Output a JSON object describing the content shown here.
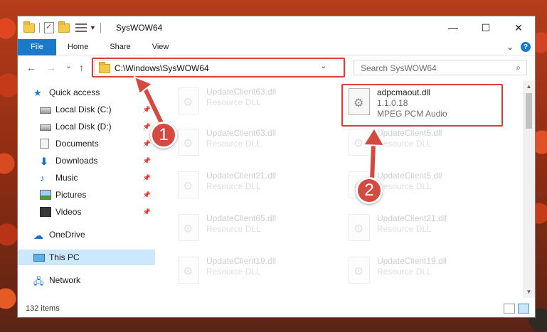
{
  "window": {
    "title": "SysWOW64"
  },
  "title_bar": {
    "minimize": "—",
    "maximize": "☐",
    "close": "✕"
  },
  "ribbon": {
    "tabs": [
      "File",
      "Home",
      "Share",
      "View"
    ],
    "collapse": "⌄",
    "help": "?"
  },
  "navigation": {
    "back": "←",
    "forward": "→",
    "recent": "⌄",
    "up": "↑",
    "address": "C:\\Windows\\SysWOW64",
    "address_dropdown": "⌄",
    "refresh": "↻",
    "search_placeholder": "Search SysWOW64",
    "search_icon": "⌕"
  },
  "sidebar": {
    "quick_access": "Quick access",
    "items": [
      {
        "label": "Local Disk (C:)",
        "icon": "drive-icon",
        "pinned": true
      },
      {
        "label": "Local Disk (D:)",
        "icon": "drive-icon",
        "pinned": true
      },
      {
        "label": "Documents",
        "icon": "documents-icon",
        "pinned": true
      },
      {
        "label": "Downloads",
        "icon": "downloads-icon",
        "pinned": true
      },
      {
        "label": "Music",
        "icon": "music-icon",
        "pinned": true
      },
      {
        "label": "Pictures",
        "icon": "pictures-icon",
        "pinned": true
      },
      {
        "label": "Videos",
        "icon": "videos-icon",
        "pinned": true
      }
    ],
    "onedrive": "OneDrive",
    "this_pc": "This PC",
    "network": "Network",
    "pin_glyph": "📌"
  },
  "files": {
    "highlighted": {
      "name": "adpcmaout.dll",
      "version": "1.1.0.18",
      "description": "MPEG PCM Audio"
    },
    "left_column": [
      {
        "name": "UpdateClient63.dll",
        "type": "Resource DLL"
      },
      {
        "name": "UpdateClient63.dll",
        "type": "Resource DLL"
      },
      {
        "name": "UpdateClient21.dll",
        "type": "Resource DLL"
      },
      {
        "name": "UpdateClient65.dll",
        "type": "Resource DLL"
      },
      {
        "name": "UpdateClient19.dll",
        "type": "Resource DLL"
      }
    ],
    "right_column": [
      {
        "name": "UpdateClient5.dll",
        "type": "Resource DLL"
      },
      {
        "name": "UpdateClient5.dll",
        "type": "Resource DLL"
      },
      {
        "name": "UpdateClient21.dll",
        "type": "Resource DLL"
      },
      {
        "name": "UpdateClient19.dll",
        "type": "Resource DLL"
      }
    ]
  },
  "status": {
    "item_count": "132 items"
  },
  "callouts": {
    "first": "1",
    "second": "2"
  },
  "colors": {
    "accent": "#1979ca",
    "highlight_box": "#d6403a",
    "callout": "#d34a40",
    "selected": "#cce8ff"
  }
}
